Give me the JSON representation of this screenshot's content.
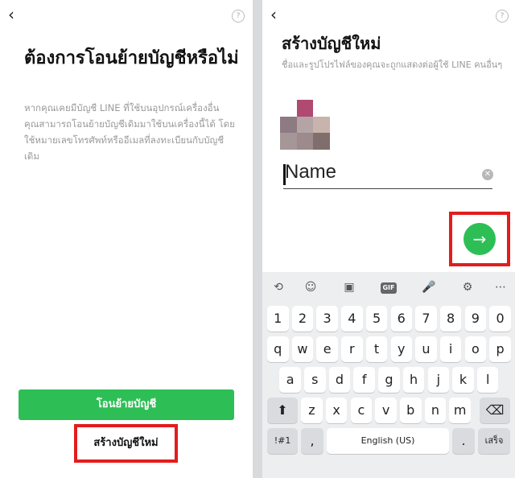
{
  "left_screen": {
    "back_glyph": "‹",
    "help_glyph": "?",
    "title": "ต้องการโอนย้ายบัญชีหรือไม่",
    "description": "หากคุณเคยมีบัญชี LINE ที่ใช้บนอุปกรณ์เครื่องอื่น คุณสามารถโอนย้ายบัญชีเดิมมาใช้บนเครื่องนี้ได้ โดยใช้หมายเลขโทรศัพท์หรืออีเมลที่ลงทะเบียนกับบัญชีเดิม",
    "transfer_button": "โอนย้ายบัญชี",
    "create_button": "สร้างบัญชีใหม่",
    "highlight_color": "#e31c1c",
    "accent_color": "#2dbf55"
  },
  "right_screen": {
    "back_glyph": "‹",
    "help_glyph": "?",
    "title": "สร้างบัญชีใหม่",
    "description": "ชื่อและรูปโปรไฟล์ของคุณจะถูกแสดงต่อผู้ใช้ LINE คนอื่นๆ",
    "name_value": "Name",
    "clear_glyph": "✕",
    "next_glyph": "→",
    "avatar_colors": [
      "#ffffff",
      "#b04a72",
      "#ffffff",
      "#8e7a82",
      "#b5a4a6",
      "#c9b3ad",
      "#a59698",
      "#9c8a8c",
      "#7f6e6c"
    ]
  },
  "keyboard": {
    "toolbar": [
      "translate-icon",
      "emoji-icon",
      "sticker-icon",
      "GIF",
      "mic-icon",
      "settings-icon",
      "more-icon"
    ],
    "toolbar_glyphs": {
      "translate": "⟲",
      "emoji": "☺",
      "sticker": "▣",
      "gif": "GIF",
      "mic": "🎤",
      "settings": "⚙",
      "more": "⋯"
    },
    "row_numbers": [
      "1",
      "2",
      "3",
      "4",
      "5",
      "6",
      "7",
      "8",
      "9",
      "0"
    ],
    "row_q": [
      "q",
      "w",
      "e",
      "r",
      "t",
      "y",
      "u",
      "i",
      "o",
      "p"
    ],
    "row_a": [
      "a",
      "s",
      "d",
      "f",
      "g",
      "h",
      "j",
      "k",
      "l"
    ],
    "row_z": [
      "z",
      "x",
      "c",
      "v",
      "b",
      "n",
      "m"
    ],
    "shift_glyph": "⬆",
    "backspace_glyph": "⌫",
    "symbols_label": "!#1",
    "comma_label": ",",
    "space_label": "English (US)",
    "period_label": ".",
    "enter_label": "เสร็จ"
  }
}
